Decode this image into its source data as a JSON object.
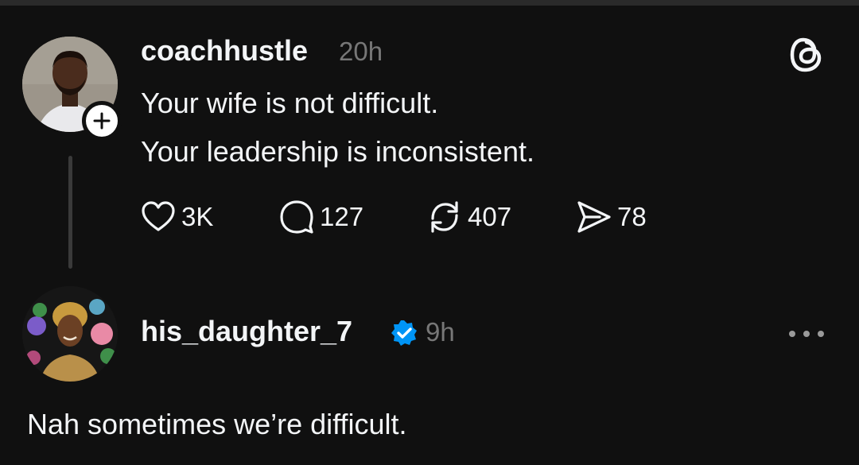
{
  "post": {
    "username": "coachhustle",
    "time": "20h",
    "body": [
      "Your wife is not difficult.",
      "Your leadership is inconsistent."
    ],
    "actions": {
      "likes": "3K",
      "replies": "127",
      "reposts": "407",
      "shares": "78"
    },
    "follow_icon": "plus-icon"
  },
  "reply": {
    "username": "his_daughter_7",
    "verified": true,
    "time": "9h",
    "text": "Nah sometimes we’re difficult.",
    "more_icon": "ellipsis-icon"
  },
  "brand": {
    "logo": "threads-logo-icon"
  },
  "colors": {
    "background": "#101010",
    "text": "#f3f5f7",
    "muted": "#777777",
    "verified": "#0095f6"
  }
}
